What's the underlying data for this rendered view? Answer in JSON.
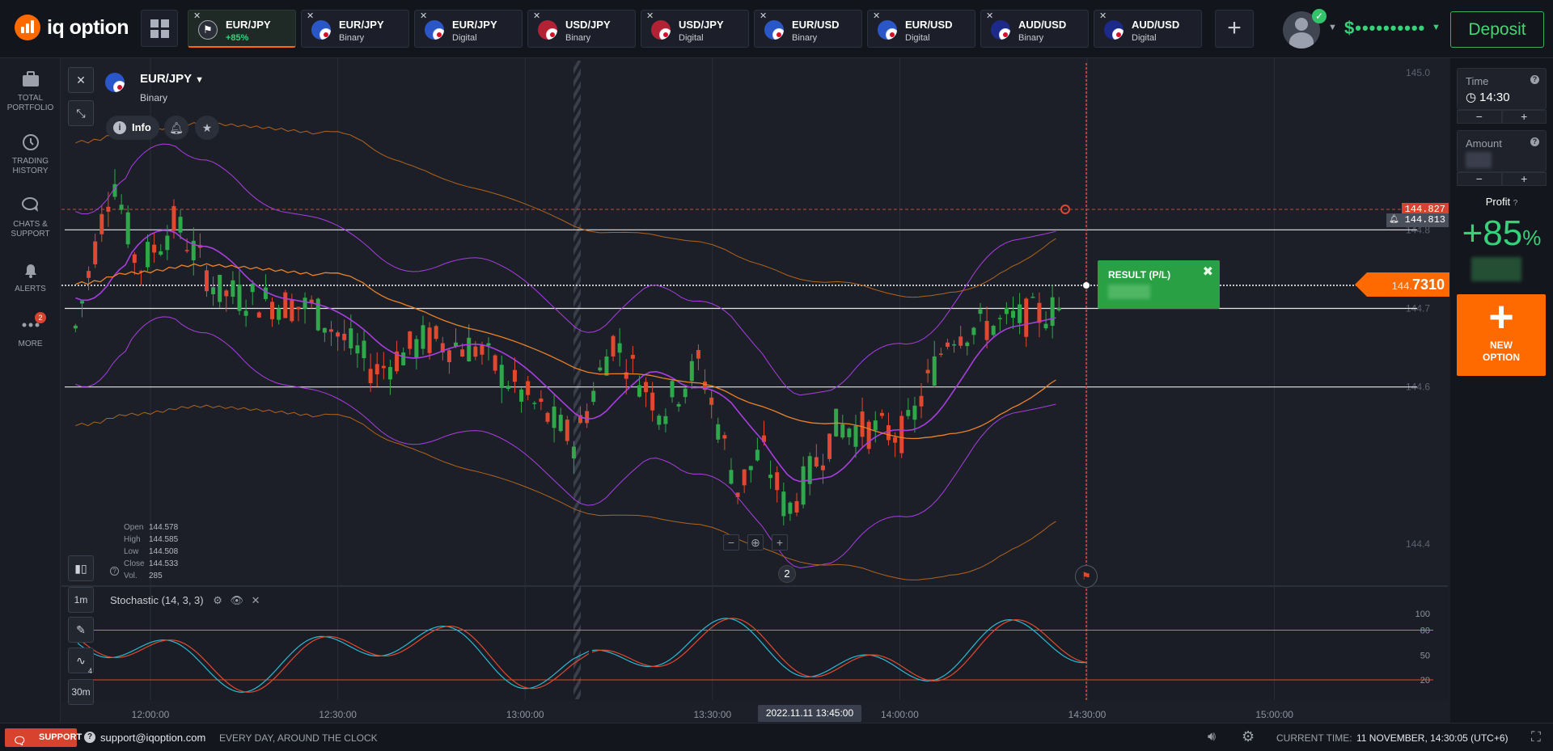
{
  "brand": {
    "name": "iq option"
  },
  "tabs": [
    {
      "pair": "EUR/JPY",
      "sub": "+85%",
      "active": true
    },
    {
      "pair": "EUR/JPY",
      "sub": "Binary"
    },
    {
      "pair": "EUR/JPY",
      "sub": "Digital"
    },
    {
      "pair": "USD/JPY",
      "sub": "Binary"
    },
    {
      "pair": "USD/JPY",
      "sub": "Digital"
    },
    {
      "pair": "EUR/USD",
      "sub": "Binary"
    },
    {
      "pair": "EUR/USD",
      "sub": "Digital"
    },
    {
      "pair": "AUD/USD",
      "sub": "Binary"
    },
    {
      "pair": "AUD/USD",
      "sub": "Digital"
    }
  ],
  "account": {
    "balance": "$••••••••••",
    "deposit_label": "Deposit"
  },
  "sidebar": {
    "items": [
      {
        "label": "TOTAL PORTFOLIO"
      },
      {
        "label": "TRADING HISTORY"
      },
      {
        "label": "CHATS & SUPPORT"
      },
      {
        "label": "ALERTS"
      },
      {
        "label": "MORE",
        "badge": "2"
      }
    ]
  },
  "asset": {
    "name": "EUR/JPY",
    "type": "Binary",
    "info_label": "Info"
  },
  "ohlc": {
    "labels": [
      "Open",
      "High",
      "Low",
      "Close",
      "Vol."
    ],
    "values": [
      "144.578",
      "144.585",
      "144.508",
      "144.533",
      "285"
    ]
  },
  "indicator": {
    "label": "Stochastic (14, 3, 3)"
  },
  "timeframes": {
    "candle": "1m",
    "period": "30m",
    "draw_badge": "4"
  },
  "price_axis": {
    "ticks": [
      "145.0",
      "144.8",
      "144.7",
      "144.6",
      "144.4"
    ]
  },
  "price_tags": {
    "high": "144.827",
    "alert": "144.813",
    "current_prefix": "144.",
    "current_suffix": "7310"
  },
  "stoch_axis": [
    "100",
    "80",
    "50",
    "20"
  ],
  "time_axis": [
    "12:00:00",
    "12:30:00",
    "13:00:00",
    "13:30:00",
    "14:00:00",
    "14:30:00",
    "15:00:00"
  ],
  "date_label": "2022.11.11 13:45:00",
  "marker": "2",
  "result": {
    "title": "RESULT (P/L)"
  },
  "right_panel": {
    "time_label": "Time",
    "time_value": "14:30",
    "amount_label": "Amount",
    "profit_label": "Profit",
    "profit_value": "+85",
    "profit_unit": "%",
    "new_option": "NEW OPTION"
  },
  "footer": {
    "support": "SUPPORT",
    "email": "support@iqoption.com",
    "hours": "EVERY DAY, AROUND THE CLOCK",
    "current_time_label": "CURRENT TIME:",
    "current_time_value": "11 NOVEMBER, 14:30:05 (UTC+6)"
  },
  "colors": {
    "accent": "#ff6a00",
    "bull": "#2ea84a",
    "bear": "#e0492f",
    "profit": "#36d27a",
    "bollinger": "#a93ee0",
    "ma": "#e8832a"
  }
}
